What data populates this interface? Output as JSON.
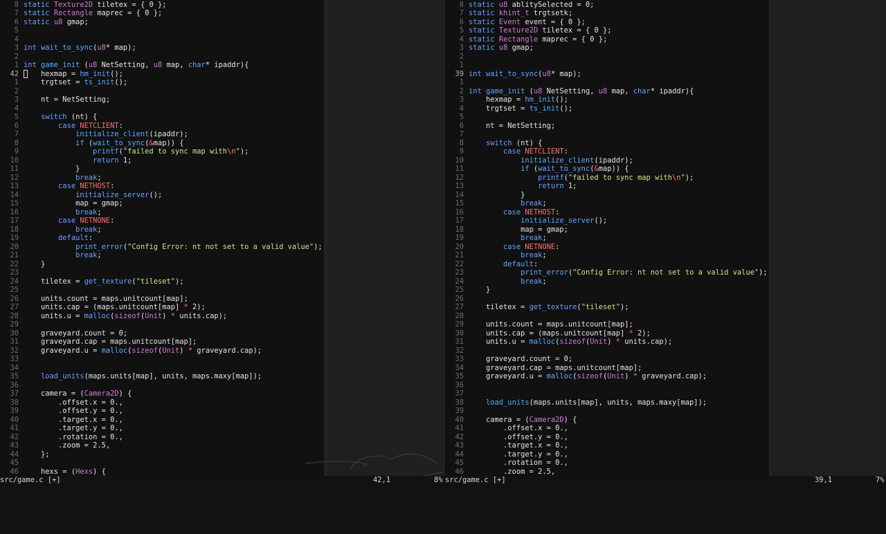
{
  "left": {
    "lines": [
      {
        "n": "8",
        "c": "static Texture2D tiletex = { 0 };"
      },
      {
        "n": "7",
        "c": "static Rectangle maprec = { 0 };"
      },
      {
        "n": "6",
        "c": "static u8 gmap;"
      },
      {
        "n": "5",
        "c": ""
      },
      {
        "n": "4",
        "c": ""
      },
      {
        "n": "3",
        "c": "int wait_to_sync(u8* map);"
      },
      {
        "n": "2",
        "c": ""
      },
      {
        "n": "1",
        "c": "int game_init (u8 NetSetting, u8 map, char* ipaddr){"
      },
      {
        "n": "42",
        "c": "    hexmap = hm_init();",
        "cur": true
      },
      {
        "n": "1",
        "c": "    trgtset = ts_init();"
      },
      {
        "n": "2",
        "c": ""
      },
      {
        "n": "3",
        "c": "    nt = NetSetting;"
      },
      {
        "n": "4",
        "c": ""
      },
      {
        "n": "5",
        "c": "    switch (nt) {"
      },
      {
        "n": "6",
        "c": "        case NETCLIENT:"
      },
      {
        "n": "7",
        "c": "            initialize_client(ipaddr);"
      },
      {
        "n": "8",
        "c": "            if (wait_to_sync(&map)) {"
      },
      {
        "n": "9",
        "c": "                printf(\"failed to sync map with\\n\");"
      },
      {
        "n": "10",
        "c": "                return 1;"
      },
      {
        "n": "11",
        "c": "            }"
      },
      {
        "n": "12",
        "c": "            break;"
      },
      {
        "n": "13",
        "c": "        case NETHOST:"
      },
      {
        "n": "14",
        "c": "            initialize_server();"
      },
      {
        "n": "15",
        "c": "            map = gmap;"
      },
      {
        "n": "16",
        "c": "            break;"
      },
      {
        "n": "17",
        "c": "        case NETNONE:"
      },
      {
        "n": "18",
        "c": "            break;"
      },
      {
        "n": "19",
        "c": "        default:"
      },
      {
        "n": "20",
        "c": "            print_error(\"Config Error: nt not set to a valid value\");"
      },
      {
        "n": "21",
        "c": "            break;"
      },
      {
        "n": "22",
        "c": "    }"
      },
      {
        "n": "23",
        "c": ""
      },
      {
        "n": "24",
        "c": "    tiletex = get_texture(\"tileset\");"
      },
      {
        "n": "25",
        "c": ""
      },
      {
        "n": "26",
        "c": "    units.count = maps.unitcount[map];"
      },
      {
        "n": "27",
        "c": "    units.cap = (maps.unitcount[map] * 2);"
      },
      {
        "n": "28",
        "c": "    units.u = malloc(sizeof(Unit) * units.cap);"
      },
      {
        "n": "29",
        "c": ""
      },
      {
        "n": "30",
        "c": "    graveyard.count = 0;"
      },
      {
        "n": "31",
        "c": "    graveyard.cap = maps.unitcount[map];"
      },
      {
        "n": "32",
        "c": "    graveyard.u = malloc(sizeof(Unit) * graveyard.cap);"
      },
      {
        "n": "33",
        "c": ""
      },
      {
        "n": "34",
        "c": ""
      },
      {
        "n": "35",
        "c": "    load_units(maps.units[map], units, maps.maxy[map]);"
      },
      {
        "n": "36",
        "c": ""
      },
      {
        "n": "37",
        "c": "    camera = (Camera2D) {"
      },
      {
        "n": "38",
        "c": "        .offset.x = 0.,"
      },
      {
        "n": "39",
        "c": "        .offset.y = 0.,"
      },
      {
        "n": "40",
        "c": "        .target.x = 0.,"
      },
      {
        "n": "41",
        "c": "        .target.y = 0.,"
      },
      {
        "n": "42",
        "c": "        .rotation = 0.,"
      },
      {
        "n": "43",
        "c": "        .zoom = 2.5,"
      },
      {
        "n": "44",
        "c": "    };"
      },
      {
        "n": "45",
        "c": ""
      },
      {
        "n": "46",
        "c": "    hexs = (Hexs) {"
      }
    ]
  },
  "right": {
    "lines": [
      {
        "n": "8",
        "c": "static u8 ablitySelected = 0;"
      },
      {
        "n": "7",
        "c": "static khint_t trgtsetk;"
      },
      {
        "n": "6",
        "c": "static Event event = { 0 };"
      },
      {
        "n": "5",
        "c": "static Texture2D tiletex = { 0 };"
      },
      {
        "n": "4",
        "c": "static Rectangle maprec = { 0 };"
      },
      {
        "n": "3",
        "c": "static u8 gmap;"
      },
      {
        "n": "2",
        "c": ""
      },
      {
        "n": "1",
        "c": ""
      },
      {
        "n": "39",
        "c": "int wait_to_sync(u8* map);",
        "cur": true
      },
      {
        "n": "1",
        "c": ""
      },
      {
        "n": "2",
        "c": "int game_init (u8 NetSetting, u8 map, char* ipaddr){"
      },
      {
        "n": "3",
        "c": "    hexmap = hm_init();"
      },
      {
        "n": "4",
        "c": "    trgtset = ts_init();"
      },
      {
        "n": "5",
        "c": ""
      },
      {
        "n": "6",
        "c": "    nt = NetSetting;"
      },
      {
        "n": "7",
        "c": ""
      },
      {
        "n": "8",
        "c": "    switch (nt) {"
      },
      {
        "n": "9",
        "c": "        case NETCLIENT:"
      },
      {
        "n": "10",
        "c": "            initialize_client(ipaddr);"
      },
      {
        "n": "11",
        "c": "            if (wait_to_sync(&map)) {"
      },
      {
        "n": "12",
        "c": "                printf(\"failed to sync map with\\n\");"
      },
      {
        "n": "13",
        "c": "                return 1;"
      },
      {
        "n": "14",
        "c": "            }"
      },
      {
        "n": "15",
        "c": "            break;"
      },
      {
        "n": "16",
        "c": "        case NETHOST:"
      },
      {
        "n": "17",
        "c": "            initialize_server();"
      },
      {
        "n": "18",
        "c": "            map = gmap;"
      },
      {
        "n": "19",
        "c": "            break;"
      },
      {
        "n": "20",
        "c": "        case NETNONE:"
      },
      {
        "n": "21",
        "c": "            break;"
      },
      {
        "n": "22",
        "c": "        default:"
      },
      {
        "n": "23",
        "c": "            print_error(\"Config Error: nt not set to a valid value\");"
      },
      {
        "n": "24",
        "c": "            break;"
      },
      {
        "n": "25",
        "c": "    }"
      },
      {
        "n": "26",
        "c": ""
      },
      {
        "n": "27",
        "c": "    tiletex = get_texture(\"tileset\");"
      },
      {
        "n": "28",
        "c": ""
      },
      {
        "n": "29",
        "c": "    units.count = maps.unitcount[map];"
      },
      {
        "n": "30",
        "c": "    units.cap = (maps.unitcount[map] * 2);"
      },
      {
        "n": "31",
        "c": "    units.u = malloc(sizeof(Unit) * units.cap);"
      },
      {
        "n": "32",
        "c": ""
      },
      {
        "n": "33",
        "c": "    graveyard.count = 0;"
      },
      {
        "n": "34",
        "c": "    graveyard.cap = maps.unitcount[map];"
      },
      {
        "n": "35",
        "c": "    graveyard.u = malloc(sizeof(Unit) * graveyard.cap);"
      },
      {
        "n": "36",
        "c": ""
      },
      {
        "n": "37",
        "c": ""
      },
      {
        "n": "38",
        "c": "    load_units(maps.units[map], units, maps.maxy[map]);"
      },
      {
        "n": "39",
        "c": ""
      },
      {
        "n": "40",
        "c": "    camera = (Camera2D) {"
      },
      {
        "n": "41",
        "c": "        .offset.x = 0.,"
      },
      {
        "n": "42",
        "c": "        .offset.y = 0.,"
      },
      {
        "n": "43",
        "c": "        .target.x = 0.,"
      },
      {
        "n": "44",
        "c": "        .target.y = 0.,"
      },
      {
        "n": "45",
        "c": "        .rotation = 0.,"
      },
      {
        "n": "46",
        "c": "        .zoom = 2.5,"
      }
    ]
  },
  "status": {
    "left_file": "src/game.c [+]",
    "left_pos": "42,1",
    "left_pct": "8%",
    "right_file": "src/game.c [+]",
    "right_pos": "39,1",
    "right_pct": "7%"
  },
  "colors": {
    "background": "#111111",
    "keyword": "#6aa1ff",
    "type": "#d07ad8",
    "function": "#5ba9ff",
    "string": "#c7e88a",
    "macro": "#ff6f6f"
  }
}
